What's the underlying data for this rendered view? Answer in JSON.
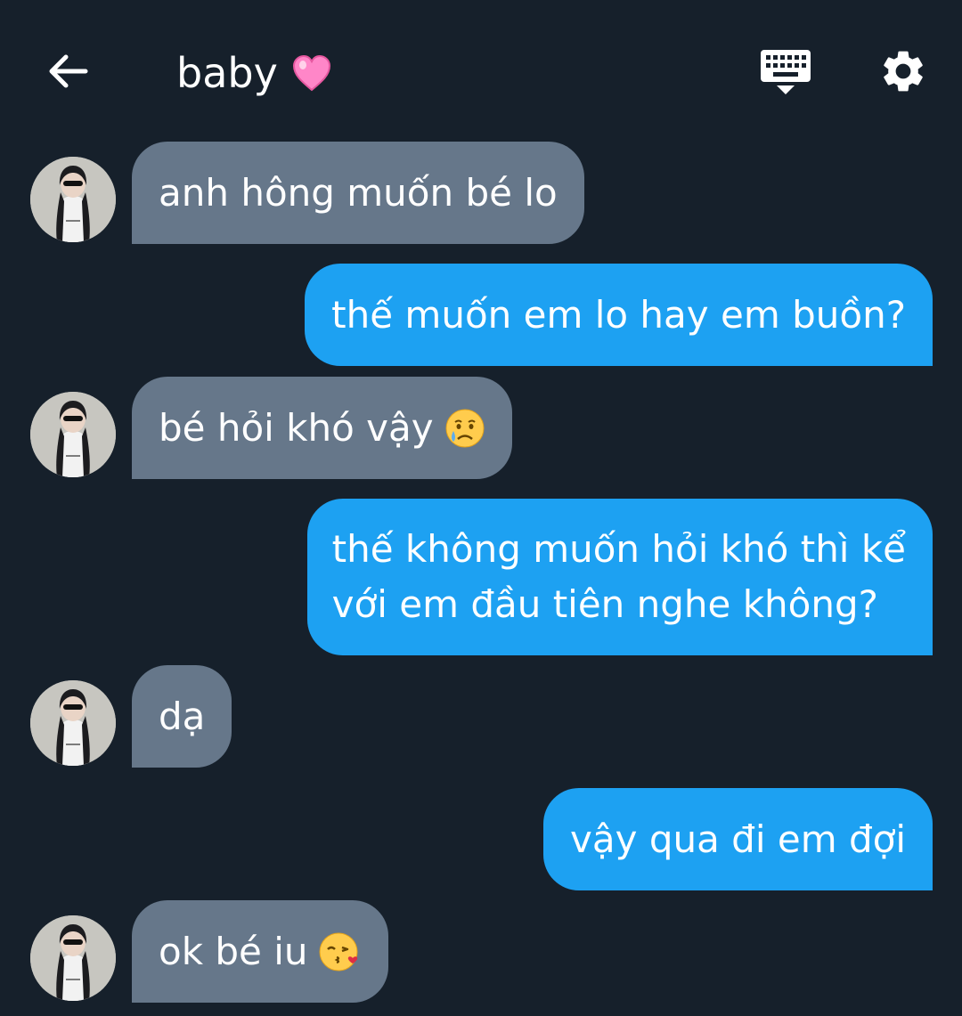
{
  "header": {
    "title": "baby",
    "title_emoji": "pink-heart",
    "back_icon": "arrow-left-icon",
    "keyboard_icon": "keyboard-hide-icon",
    "settings_icon": "gear-icon"
  },
  "colors": {
    "background": "#16202b",
    "incoming_bubble": "#66778a",
    "outgoing_bubble": "#1da1f2",
    "text": "#ffffff"
  },
  "messages": [
    {
      "direction": "incoming",
      "text": "anh hông muốn bé lo",
      "emoji": ""
    },
    {
      "direction": "outgoing",
      "text": "thế muốn em lo hay em buồn?",
      "emoji": ""
    },
    {
      "direction": "incoming",
      "text": "bé hỏi khó vậy",
      "emoji": "crying-face"
    },
    {
      "direction": "outgoing",
      "lines": [
        "thế không muốn hỏi khó thì kể",
        "với em đầu tiên nghe không?"
      ]
    },
    {
      "direction": "incoming",
      "text": "dạ",
      "emoji": ""
    },
    {
      "direction": "outgoing",
      "text": "vậy qua đi em đợi",
      "emoji": ""
    },
    {
      "direction": "incoming",
      "text": "ok bé iu",
      "emoji": "face-blowing-kiss"
    }
  ]
}
